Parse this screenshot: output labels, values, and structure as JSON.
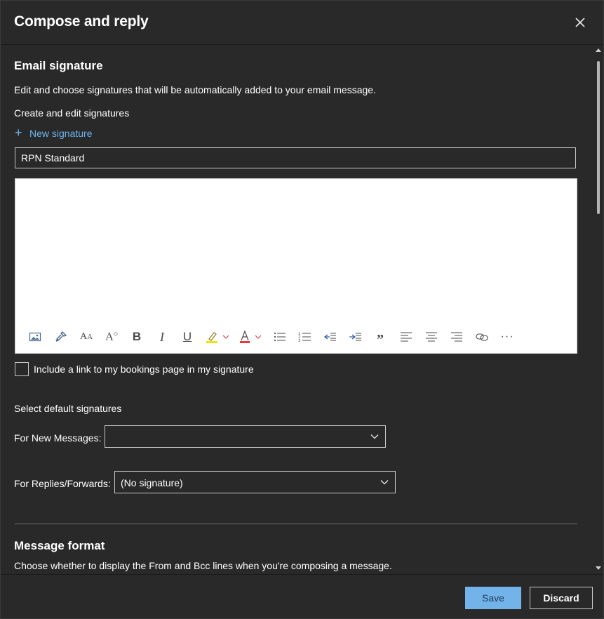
{
  "dialog": {
    "title": "Compose and reply"
  },
  "signature": {
    "heading": "Email signature",
    "description": "Edit and choose signatures that will be automatically added to your email message.",
    "create_label": "Create and edit signatures",
    "new_signature_label": "New signature",
    "name_value": "RPN Standard",
    "bookings_checkbox_label": "Include a link to my bookings page in my signature",
    "bookings_checked": false
  },
  "toolbar": {
    "icons": [
      "insert-picture-icon",
      "format-painter-icon",
      "font-size-icon",
      "superscript-icon",
      "bold-icon",
      "italic-icon",
      "underline-icon",
      "highlight-icon",
      "font-color-icon",
      "bullets-icon",
      "numbering-icon",
      "decrease-indent-icon",
      "increase-indent-icon",
      "quote-icon",
      "align-left-icon",
      "align-center-icon",
      "align-right-icon",
      "link-icon",
      "more-options-icon"
    ],
    "highlight_color": "#f2e400",
    "font_color": "#e03a3a"
  },
  "defaults": {
    "heading": "Select default signatures",
    "new_messages_label": "For New Messages:",
    "new_messages_value": "",
    "replies_label": "For Replies/Forwards:",
    "replies_value": "(No signature)"
  },
  "message_format": {
    "heading": "Message format",
    "description": "Choose whether to display the From and Bcc lines when you're composing a message."
  },
  "footer": {
    "save_label": "Save",
    "discard_label": "Discard"
  },
  "colors": {
    "background": "#292929",
    "accent": "#6cb4ee",
    "save_button": "#72b3ea"
  }
}
